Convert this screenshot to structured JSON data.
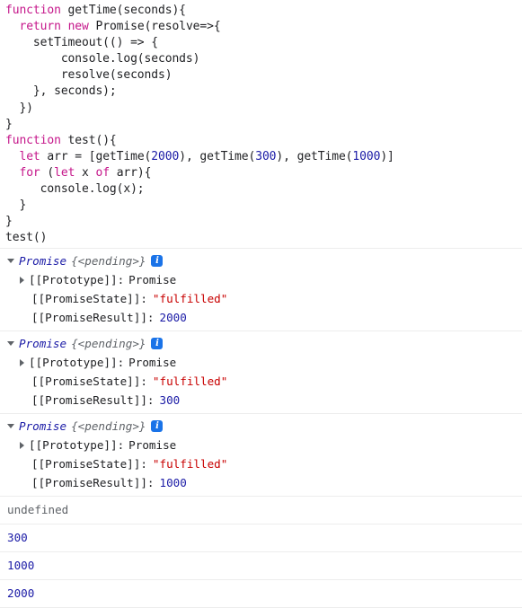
{
  "app": {
    "name": "browser-devtools-console",
    "colors": {
      "keyword": "#c5168a",
      "number": "#1a1aa6",
      "string": "#c80000",
      "muted": "#5f6368",
      "text": "#202124",
      "divider": "#ededed",
      "info_badge": "#1a73e8"
    }
  },
  "code": {
    "lines": [
      [
        {
          "t": "function",
          "c": "kw"
        },
        {
          "t": " getTime(seconds){",
          "c": "plain"
        }
      ],
      [
        {
          "t": "  ",
          "c": "plain"
        },
        {
          "t": "return",
          "c": "kw"
        },
        {
          "t": " ",
          "c": "plain"
        },
        {
          "t": "new",
          "c": "kw"
        },
        {
          "t": " Promise(resolve=>{",
          "c": "plain"
        }
      ],
      [
        {
          "t": "    setTimeout(() => {",
          "c": "plain"
        }
      ],
      [
        {
          "t": "        console.log(seconds)",
          "c": "plain"
        }
      ],
      [
        {
          "t": "        resolve(seconds)",
          "c": "plain"
        }
      ],
      [
        {
          "t": "    }, seconds);",
          "c": "plain"
        }
      ],
      [
        {
          "t": "  })",
          "c": "plain"
        }
      ],
      [
        {
          "t": "}",
          "c": "plain"
        }
      ],
      [
        {
          "t": "function",
          "c": "kw"
        },
        {
          "t": " test(){",
          "c": "plain"
        }
      ],
      [
        {
          "t": "  ",
          "c": "plain"
        },
        {
          "t": "let",
          "c": "kw"
        },
        {
          "t": " arr = [getTime(",
          "c": "plain"
        },
        {
          "t": "2000",
          "c": "num"
        },
        {
          "t": "), getTime(",
          "c": "plain"
        },
        {
          "t": "300",
          "c": "num"
        },
        {
          "t": "), getTime(",
          "c": "plain"
        },
        {
          "t": "1000",
          "c": "num"
        },
        {
          "t": ")]",
          "c": "plain"
        }
      ],
      [
        {
          "t": "  ",
          "c": "plain"
        },
        {
          "t": "for",
          "c": "kw"
        },
        {
          "t": " (",
          "c": "plain"
        },
        {
          "t": "let",
          "c": "kw"
        },
        {
          "t": " x ",
          "c": "plain"
        },
        {
          "t": "of",
          "c": "kw"
        },
        {
          "t": " arr){",
          "c": "plain"
        }
      ],
      [
        {
          "t": "     console.log(x);",
          "c": "plain"
        }
      ],
      [
        {
          "t": "  }",
          "c": "plain"
        }
      ],
      [
        {
          "t": "}",
          "c": "plain"
        }
      ],
      [
        {
          "t": "test()",
          "c": "plain"
        }
      ]
    ]
  },
  "promises": [
    {
      "name": "Promise",
      "pending": "{<pending>}",
      "info_icon": "info-icon",
      "info_glyph": "i",
      "prototype_key": "[[Prototype]]:",
      "prototype_value": "Promise",
      "state_key": "[[PromiseState]]:",
      "state_value": "\"fulfilled\"",
      "result_key": "[[PromiseResult]]:",
      "result_value": "2000"
    },
    {
      "name": "Promise",
      "pending": "{<pending>}",
      "info_icon": "info-icon",
      "info_glyph": "i",
      "prototype_key": "[[Prototype]]:",
      "prototype_value": "Promise",
      "state_key": "[[PromiseState]]:",
      "state_value": "\"fulfilled\"",
      "result_key": "[[PromiseResult]]:",
      "result_value": "300"
    },
    {
      "name": "Promise",
      "pending": "{<pending>}",
      "info_icon": "info-icon",
      "info_glyph": "i",
      "prototype_key": "[[Prototype]]:",
      "prototype_value": "Promise",
      "state_key": "[[PromiseState]]:",
      "state_value": "\"fulfilled\"",
      "result_key": "[[PromiseResult]]:",
      "result_value": "1000"
    }
  ],
  "output": [
    {
      "text": "undefined",
      "kind": "undefined"
    },
    {
      "text": "300",
      "kind": "number"
    },
    {
      "text": "1000",
      "kind": "number"
    },
    {
      "text": "2000",
      "kind": "number"
    }
  ]
}
